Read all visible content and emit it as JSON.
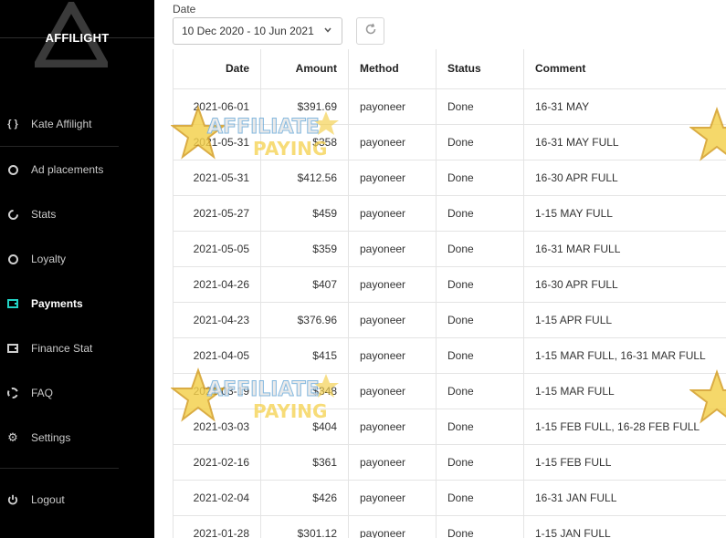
{
  "brand": {
    "logo_text": "AFFILIGHT"
  },
  "sidebar": {
    "items": [
      {
        "label": "Kate Affilight",
        "icon": "code-braces-icon",
        "active": false
      },
      {
        "label": "Ad placements",
        "icon": "circle-icon",
        "active": false
      },
      {
        "label": "Stats",
        "icon": "pie-chart-icon",
        "active": false
      },
      {
        "label": "Loyalty",
        "icon": "circle-icon",
        "active": false
      },
      {
        "label": "Payments",
        "icon": "wallet-icon",
        "active": true
      },
      {
        "label": "Finance Stat",
        "icon": "wallet-icon",
        "active": false
      },
      {
        "label": "FAQ",
        "icon": "dashed-circle-icon",
        "active": false
      },
      {
        "label": "Settings",
        "icon": "gear-icon",
        "active": false
      }
    ],
    "logout_label": "Logout"
  },
  "filter": {
    "date_label": "Date",
    "date_range": "10 Dec 2020 - 10 Jun 2021"
  },
  "watermark": {
    "line1": "AFFILIATE",
    "line2": "PAYING"
  },
  "table": {
    "columns": [
      "Date",
      "Amount",
      "Method",
      "Status",
      "Comment"
    ],
    "rows": [
      {
        "date": "2021-06-01",
        "amount": "$391.69",
        "method": "payoneer",
        "status": "Done",
        "comment": "16-31 MAY"
      },
      {
        "date": "2021-05-31",
        "amount": "$358",
        "method": "payoneer",
        "status": "Done",
        "comment": "16-31 MAY FULL"
      },
      {
        "date": "2021-05-31",
        "amount": "$412.56",
        "method": "payoneer",
        "status": "Done",
        "comment": "16-30 APR FULL"
      },
      {
        "date": "2021-05-27",
        "amount": "$459",
        "method": "payoneer",
        "status": "Done",
        "comment": "1-15 MAY FULL"
      },
      {
        "date": "2021-05-05",
        "amount": "$359",
        "method": "payoneer",
        "status": "Done",
        "comment": "16-31 MAR FULL"
      },
      {
        "date": "2021-04-26",
        "amount": "$407",
        "method": "payoneer",
        "status": "Done",
        "comment": "16-30 APR FULL"
      },
      {
        "date": "2021-04-23",
        "amount": "$376.96",
        "method": "payoneer",
        "status": "Done",
        "comment": "1-15 APR FULL"
      },
      {
        "date": "2021-04-05",
        "amount": "$415",
        "method": "payoneer",
        "status": "Done",
        "comment": "1-15 MAR FULL, 16-31 MAR FULL"
      },
      {
        "date": "2021-03-19",
        "amount": "$348",
        "method": "payoneer",
        "status": "Done",
        "comment": "1-15 MAR FULL"
      },
      {
        "date": "2021-03-03",
        "amount": "$404",
        "method": "payoneer",
        "status": "Done",
        "comment": "1-15 FEB FULL, 16-28 FEB FULL"
      },
      {
        "date": "2021-02-16",
        "amount": "$361",
        "method": "payoneer",
        "status": "Done",
        "comment": "1-15 FEB FULL"
      },
      {
        "date": "2021-02-04",
        "amount": "$426",
        "method": "payoneer",
        "status": "Done",
        "comment": "16-31 JAN FULL"
      },
      {
        "date": "2021-01-28",
        "amount": "$301.12",
        "method": "payoneer",
        "status": "Done",
        "comment": "1-15 JAN FULL"
      }
    ]
  }
}
